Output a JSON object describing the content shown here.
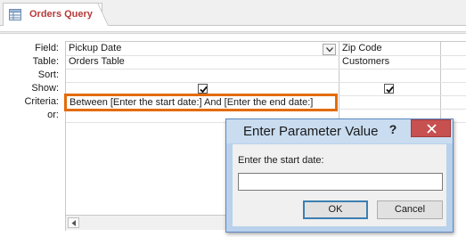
{
  "tab": {
    "title": "Orders Query",
    "icon": "query-icon"
  },
  "grid": {
    "row_labels": [
      "Field:",
      "Table:",
      "Sort:",
      "Show:",
      "Criteria:",
      "or:"
    ],
    "columns": [
      {
        "field": "Pickup Date",
        "table": "Orders Table",
        "show": true,
        "criteria": "Between [Enter the start date:] And [Enter the end date:]"
      },
      {
        "field": "Zip Code",
        "table": "Customers",
        "show": true,
        "criteria": ""
      }
    ]
  },
  "dialog": {
    "title": "Enter Parameter Value",
    "help_label": "?",
    "prompt": "Enter the start date:",
    "input_value": "",
    "ok_label": "OK",
    "cancel_label": "Cancel"
  },
  "colors": {
    "accent_tab_text": "#b73a3a",
    "criteria_highlight": "#e36c0a",
    "close_button": "#c75050"
  }
}
